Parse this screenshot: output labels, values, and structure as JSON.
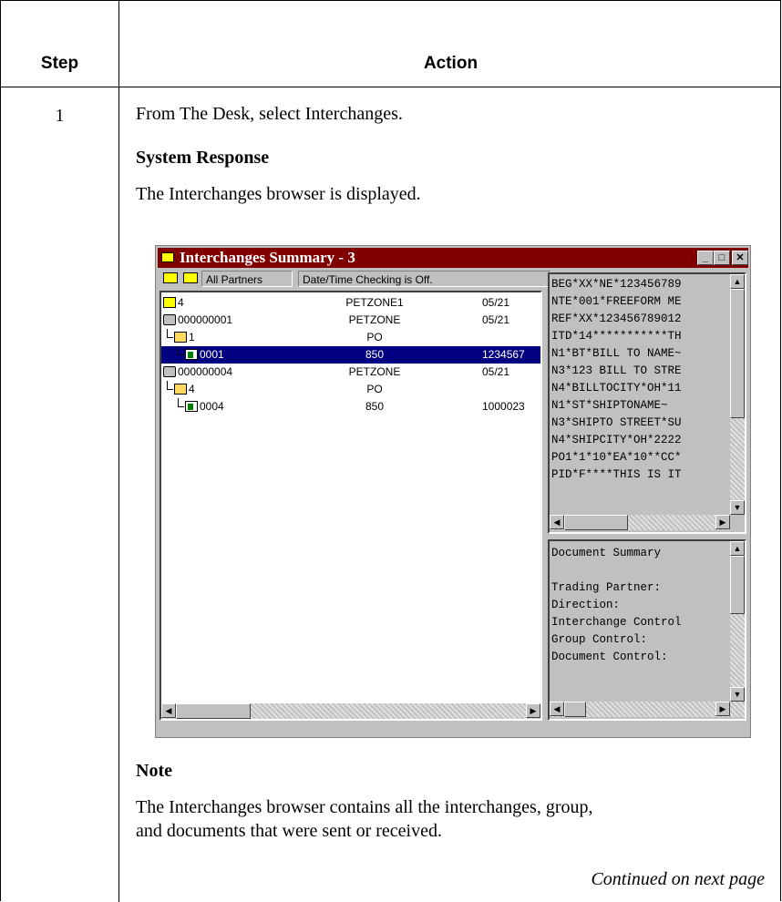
{
  "table": {
    "header_step": "Step",
    "header_action": "Action",
    "step_number": "1",
    "instruction": "From The Desk, select Interchanges.",
    "system_response_heading": "System Response",
    "system_response_text": "The Interchanges browser is displayed.",
    "note_heading": "Note",
    "note_line1": "The Interchanges browser contains all the interchanges, group,",
    "note_line2": "and documents that were sent or received.",
    "continued": "Continued on next page"
  },
  "window": {
    "title": "Interchanges Summary - 3",
    "buttons": {
      "minimize": "_",
      "maximize": "□",
      "close": "✕"
    },
    "toolbar": {
      "partners_field": "All Partners",
      "datetime_field": "Date/Time Checking is Off."
    },
    "tree": [
      {
        "icon": "envelope-icon",
        "c1": "4",
        "c2": "PETZONE1",
        "c3": "05/21",
        "level": 0
      },
      {
        "icon": "printer-icon",
        "c1": "000000001",
        "c2": "PETZONE",
        "c3": "05/21",
        "level": 0
      },
      {
        "icon": "folder-icon",
        "c1": "1",
        "c2": "PO",
        "c3": "",
        "level": 1
      },
      {
        "icon": "document-icon",
        "c1": "0001",
        "c2": "850",
        "c3": "1234567",
        "level": 2,
        "selected": true
      },
      {
        "icon": "printer-icon",
        "c1": "000000004",
        "c2": "PETZONE",
        "c3": "05/21",
        "level": 0
      },
      {
        "icon": "folder-icon",
        "c1": "4",
        "c2": "PO",
        "c3": "",
        "level": 1
      },
      {
        "icon": "document-icon",
        "c1": "0004",
        "c2": "850",
        "c3": "1000023",
        "level": 2
      }
    ],
    "segments": [
      "BEG*XX*NE*123456789",
      "NTE*001*FREEFORM ME",
      "REF*XX*123456789012",
      "ITD*14***********TH",
      "N1*BT*BILL TO NAME~",
      "N3*123 BILL TO STRE",
      "N4*BILLTOCITY*OH*11",
      "N1*ST*SHIPTONAME~",
      "N3*SHIPTO STREET*SU",
      "N4*SHIPCITY*OH*2222",
      "PO1*1*10*EA*10**CC*",
      "PID*F****THIS IS IT"
    ],
    "summary": [
      "Document Summary",
      "",
      "Trading Partner:",
      "Direction:",
      "Interchange Control",
      "Group Control:",
      "Document Control:"
    ]
  }
}
